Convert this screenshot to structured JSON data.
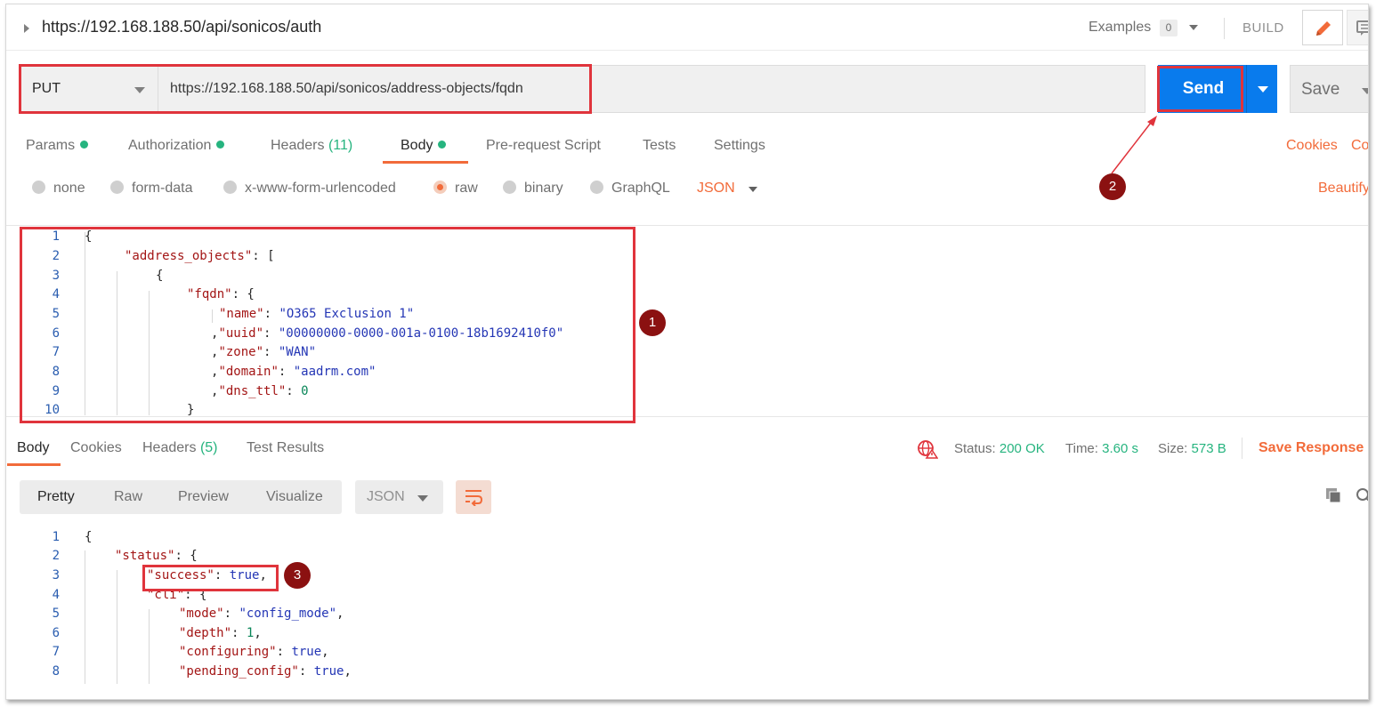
{
  "header": {
    "request_title": "https://192.168.188.50/api/sonicos/auth",
    "examples_label": "Examples",
    "examples_count": "0",
    "build_label": "BUILD"
  },
  "request": {
    "method": "PUT",
    "url": "https://192.168.188.50/api/sonicos/address-objects/fqdn",
    "send_label": "Send",
    "save_label": "Save"
  },
  "request_tabs": {
    "params": "Params",
    "authorization": "Authorization",
    "headers": "Headers",
    "headers_count": "(11)",
    "body": "Body",
    "prerequest": "Pre-request Script",
    "tests": "Tests",
    "settings": "Settings",
    "cookies": "Cookies",
    "code": "Co"
  },
  "body_types": {
    "none": "none",
    "form_data": "form-data",
    "urlencoded": "x-www-form-urlencoded",
    "raw": "raw",
    "binary": "binary",
    "graphql": "GraphQL",
    "format": "JSON",
    "beautify": "Beautify"
  },
  "request_body": {
    "line_numbers": [
      "1",
      "2",
      "3",
      "4",
      "5",
      "6",
      "7",
      "8",
      "9",
      "10"
    ],
    "l1": "{",
    "l2_key": "\"address_objects\"",
    "l2_rest": ": [",
    "l3": "{",
    "l4_key": "\"fqdn\"",
    "l4_rest": ": {",
    "l5_key": "\"name\"",
    "l5_val": "\"O365 Exclusion 1\"",
    "l6_key": "\"uuid\"",
    "l6_val": "\"00000000-0000-001a-0100-18b1692410f0\"",
    "l7_key": "\"zone\"",
    "l7_val": "\"WAN\"",
    "l8_key": "\"domain\"",
    "l8_val": "\"aadrm.com\"",
    "l9_key": "\"dns_ttl\"",
    "l9_val": "0",
    "l10": "}"
  },
  "response_tabs": {
    "body": "Body",
    "cookies": "Cookies",
    "headers": "Headers",
    "headers_count": "(5)",
    "test_results": "Test Results"
  },
  "response_meta": {
    "status_label": "Status:",
    "status_value": "200 OK",
    "time_label": "Time:",
    "time_value": "3.60 s",
    "size_label": "Size:",
    "size_value": "573 B",
    "save_response": "Save Response"
  },
  "response_view": {
    "pretty": "Pretty",
    "raw": "Raw",
    "preview": "Preview",
    "visualize": "Visualize",
    "format": "JSON"
  },
  "response_body": {
    "line_numbers": [
      "1",
      "2",
      "3",
      "4",
      "5",
      "6",
      "7",
      "8"
    ],
    "l1": "{",
    "l2_key": "\"status\"",
    "l2_rest": ": {",
    "l3_key": "\"success\"",
    "l3_val": "true",
    "l4_key": "\"cli\"",
    "l4_rest": ": {",
    "l5_key": "\"mode\"",
    "l5_val": "\"config_mode\"",
    "l6_key": "\"depth\"",
    "l6_val": "1",
    "l7_key": "\"configuring\"",
    "l7_val": "true",
    "l8_key": "\"pending_config\"",
    "l8_val": "true"
  },
  "annotations": {
    "badge1": "1",
    "badge2": "2",
    "badge3": "3"
  },
  "colors": {
    "accent": "#f26b3a",
    "send_blue": "#097bed",
    "success_green": "#26b47f",
    "highlight_red": "#e0343c",
    "badge_red": "#8b1111"
  }
}
